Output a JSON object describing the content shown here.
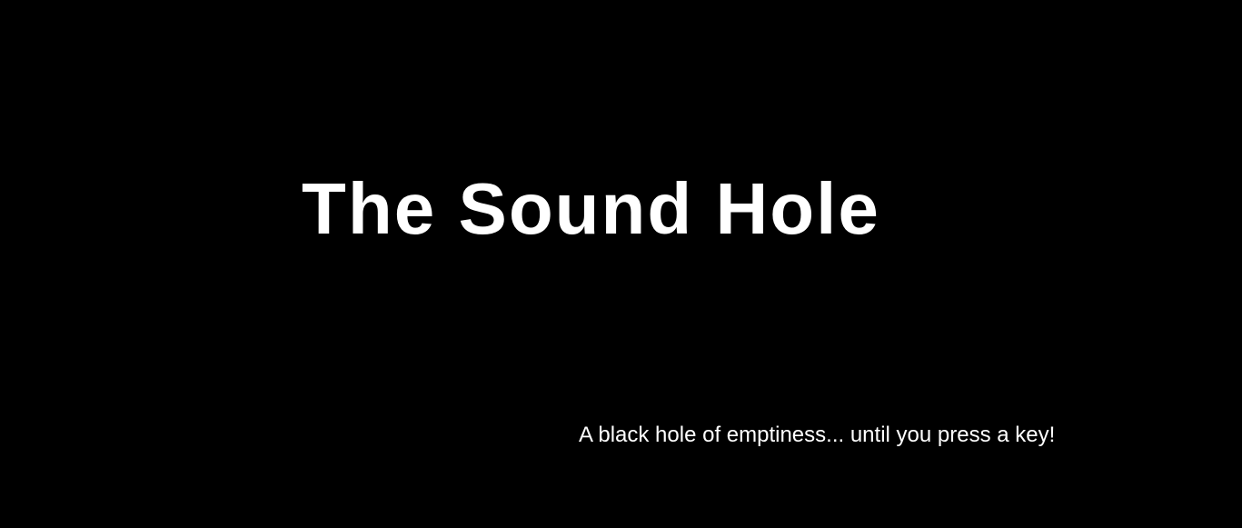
{
  "page": {
    "title": "The Sound Hole",
    "subtitle": "A black hole of emptiness... until you press a key!"
  },
  "colors": {
    "background": "#000000",
    "text": "#ffffff"
  }
}
